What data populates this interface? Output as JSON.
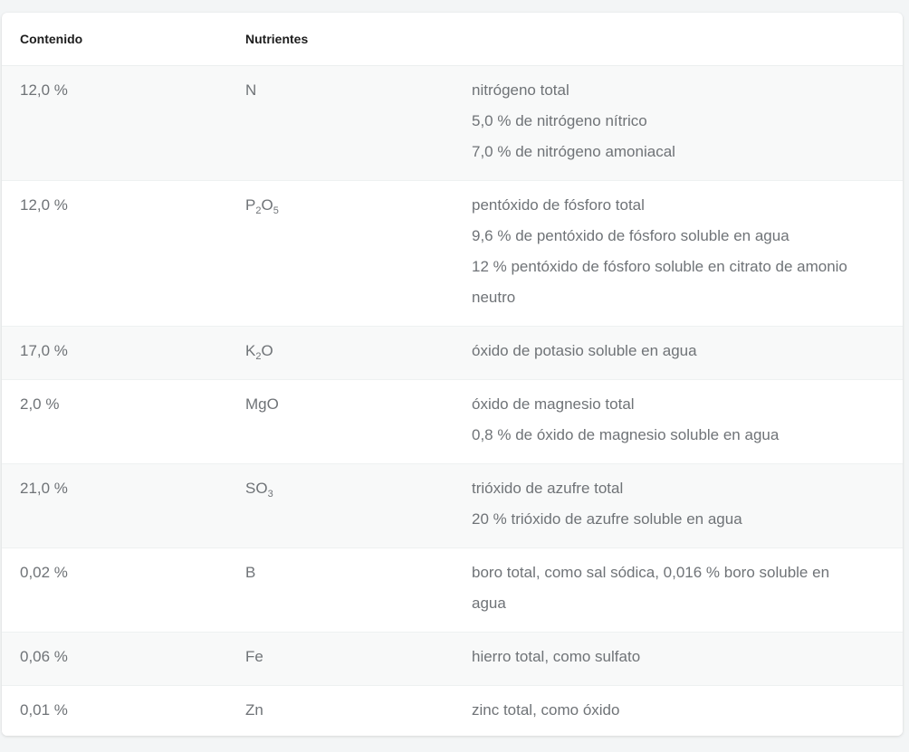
{
  "table": {
    "headers": [
      "Contenido",
      "Nutrientes",
      ""
    ],
    "rows": [
      {
        "content": "12,0 %",
        "nutrient": {
          "base": "N",
          "parts": [
            {
              "t": "N"
            }
          ]
        },
        "desc": [
          "nitrógeno total",
          "5,0 % de nitrógeno nítrico",
          "7,0 % de nitrógeno amoniacal"
        ]
      },
      {
        "content": "12,0 %",
        "nutrient": {
          "parts": [
            {
              "t": "P"
            },
            {
              "sub": "2"
            },
            {
              "t": "O"
            },
            {
              "sub": "5"
            }
          ]
        },
        "desc": [
          "pentóxido de fósforo total",
          "9,6 % de pentóxido de fósforo soluble en agua",
          "12 % pentóxido de fósforo soluble en citrato de amonio",
          "neutro"
        ]
      },
      {
        "content": "17,0 %",
        "nutrient": {
          "parts": [
            {
              "t": "K"
            },
            {
              "sub": "2"
            },
            {
              "t": "O"
            }
          ]
        },
        "desc": [
          "óxido de potasio soluble en agua"
        ]
      },
      {
        "content": "2,0 %",
        "nutrient": {
          "parts": [
            {
              "t": "MgO"
            }
          ]
        },
        "desc": [
          "óxido de magnesio total",
          "0,8 % de óxido de magnesio soluble en agua"
        ]
      },
      {
        "content": "21,0 %",
        "nutrient": {
          "parts": [
            {
              "t": "SO"
            },
            {
              "sub": "3"
            }
          ]
        },
        "desc": [
          "trióxido de azufre total",
          "20 % trióxido de azufre soluble en agua"
        ]
      },
      {
        "content": "0,02 %",
        "nutrient": {
          "parts": [
            {
              "t": "B"
            }
          ]
        },
        "desc": [
          "boro total, como sal sódica, 0,016 % boro soluble en",
          "agua"
        ]
      },
      {
        "content": "0,06 %",
        "nutrient": {
          "parts": [
            {
              "t": "Fe"
            }
          ]
        },
        "desc": [
          "hierro total, como sulfato"
        ]
      },
      {
        "content": "0,01 %",
        "nutrient": {
          "parts": [
            {
              "t": "Zn"
            }
          ]
        },
        "desc": [
          "zinc total, como óxido"
        ]
      }
    ]
  }
}
